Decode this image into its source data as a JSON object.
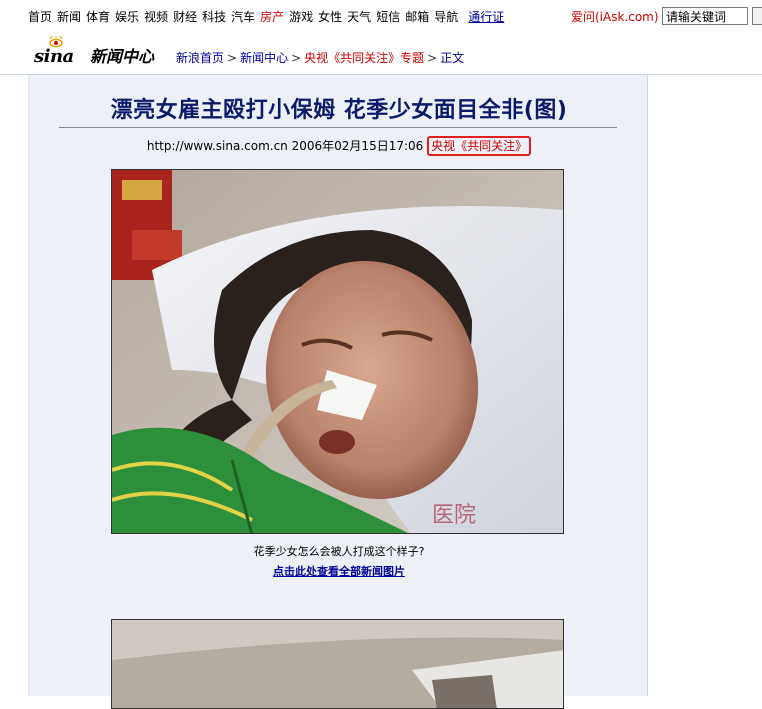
{
  "topnav": {
    "items": [
      "首页",
      "新闻",
      "体育",
      "娱乐",
      "视频",
      "财经",
      "科技",
      "汽车",
      "房产",
      "游戏",
      "女性",
      "天气",
      "短信",
      "邮箱",
      "导航"
    ],
    "highlight_item": "房产",
    "pass_label": "通行证",
    "iask_label": "爱问(iAsk.com)",
    "search_value": "请输关键词"
  },
  "header": {
    "logo_text": "sina",
    "section_title": "新闻中心",
    "breadcrumb": [
      "新浪首页",
      "新闻中心",
      "央视《共同关注》专题",
      "正文"
    ],
    "breadcrumb_sep": ">"
  },
  "article": {
    "title": "漂亮女雇主殴打小保姆 花季少女面目全非(图)",
    "source_url": "http://www.sina.com.cn",
    "datetime": "2006年02月15日17:06",
    "source_name": "央视《共同关注》",
    "photo_caption": "花季少女怎么会被人打成这个样子?",
    "more_photos_link": "点击此处查看全部新闻图片",
    "photo_watermark": "医院"
  },
  "colors": {
    "headline": "#0c1a6b",
    "link": "#000099",
    "red": "#cc0000",
    "panel_bg": "#edf1f7"
  }
}
